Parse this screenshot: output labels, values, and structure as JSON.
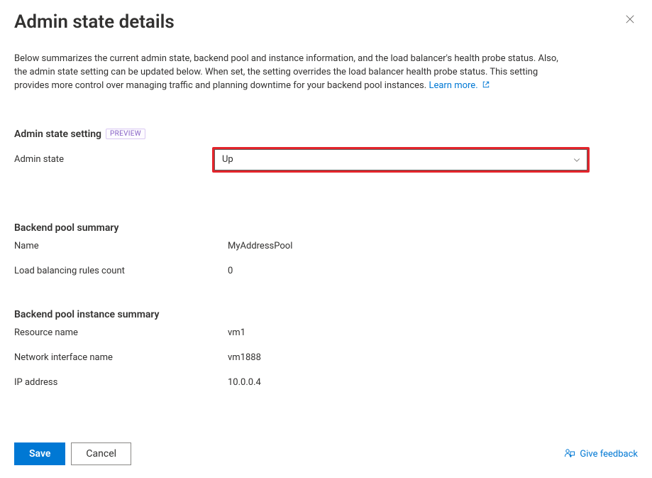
{
  "header": {
    "title": "Admin state details"
  },
  "intro": {
    "text": "Below summarizes the current admin state, backend pool and instance information, and the load balancer's health probe status. Also, the admin state setting can be updated below. When set, the setting overrides the load balancer health probe status. This setting provides more control over managing traffic and planning downtime for your backend pool instances.",
    "learn_more": "Learn more."
  },
  "admin_state_setting": {
    "heading": "Admin state setting",
    "badge": "PREVIEW",
    "label": "Admin state",
    "selected": "Up"
  },
  "backend_pool": {
    "heading": "Backend pool summary",
    "name_label": "Name",
    "name_value": "MyAddressPool",
    "rules_label": "Load balancing rules count",
    "rules_value": "0"
  },
  "instance": {
    "heading": "Backend pool instance summary",
    "resource_label": "Resource name",
    "resource_value": "vm1",
    "nic_label": "Network interface name",
    "nic_value": "vm1888",
    "ip_label": "IP address",
    "ip_value": "10.0.0.4"
  },
  "footer": {
    "save": "Save",
    "cancel": "Cancel",
    "feedback": "Give feedback"
  }
}
